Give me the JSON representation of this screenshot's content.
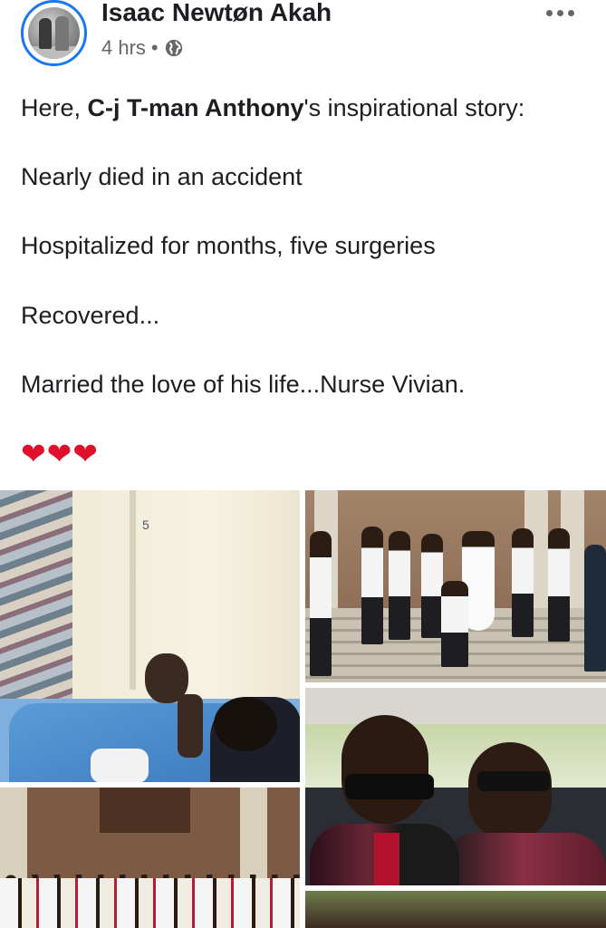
{
  "post": {
    "author": "Isaac Newtøn Akah",
    "time": "4 hrs",
    "separator": "•",
    "privacy_icon": "globe-icon",
    "more_icon": "more-options-icon",
    "text": {
      "line1_prefix": "Here, ",
      "line1_bold": "C-j T-man Anthony",
      "line1_suffix": "'s inspirational story:",
      "line2": "Nearly died in an accident",
      "line3": "Hospitalized for months, five surgeries",
      "line4": "Recovered...",
      "line5": "Married the love of his life...Nurse Vivian.",
      "hearts": "❤❤❤"
    },
    "photos": {
      "hospital_room_number": "5"
    }
  },
  "colors": {
    "accent": "#1877f2",
    "text": "#1c1e21",
    "secondary_text": "#65676b",
    "heart": "#e0102c"
  }
}
